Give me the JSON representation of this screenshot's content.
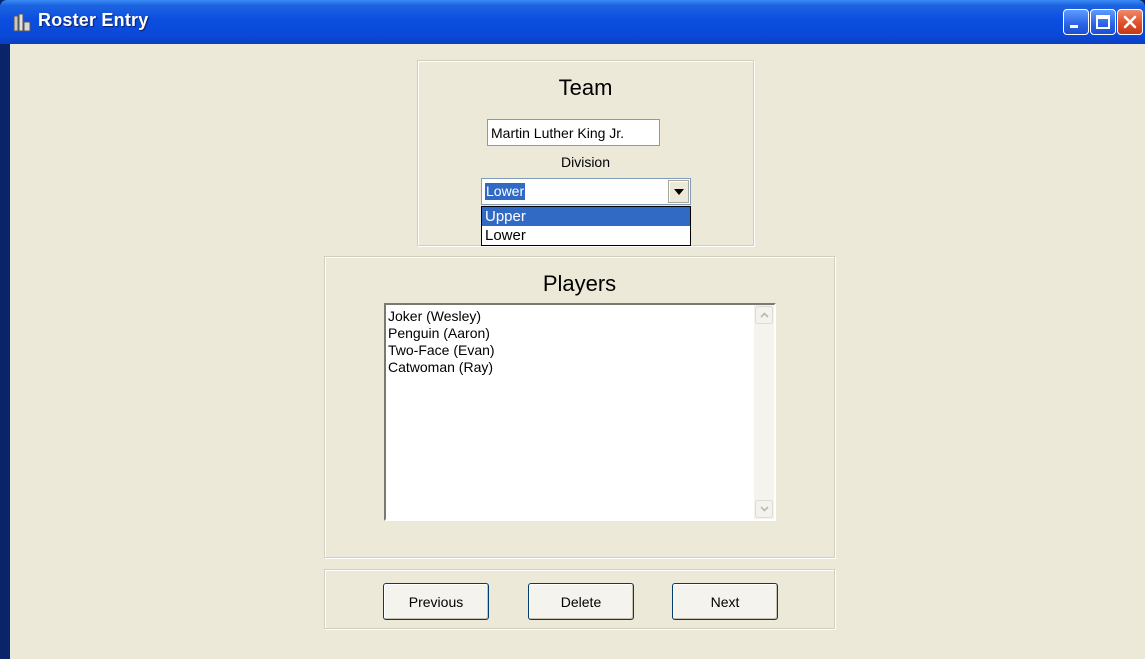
{
  "window": {
    "title": "Roster Entry"
  },
  "team": {
    "heading": "Team",
    "name_value": "Martin Luther King Jr.",
    "division_label": "Division",
    "division_selected": "Lower",
    "division_options": [
      "Upper",
      "Lower"
    ]
  },
  "players": {
    "heading": "Players",
    "items": [
      "Joker (Wesley)",
      "Penguin (Aaron)",
      "Two-Face (Evan)",
      "Catwoman (Ray)"
    ]
  },
  "buttons": {
    "previous": "Previous",
    "delete": "Delete",
    "next": "Next"
  },
  "colors": {
    "titlebar": "#0a49d8",
    "selection": "#316ac5",
    "face": "#ece9d8"
  },
  "icons": {
    "app": "roster-app-icon",
    "minimize": "minimize-icon",
    "maximize": "maximize-icon",
    "close": "close-icon",
    "dropdown": "chevron-down-icon",
    "scroll_up": "scroll-up-icon",
    "scroll_down": "scroll-down-icon"
  }
}
